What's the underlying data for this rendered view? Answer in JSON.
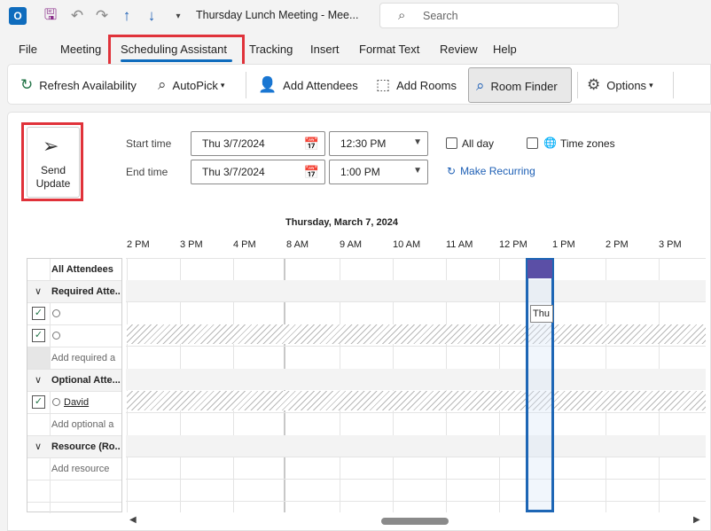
{
  "titlebar": {
    "app_icon": "outlook-icon",
    "app_letter": "O",
    "title": "Thursday Lunch Meeting  -  Mee...",
    "search_placeholder": "Search"
  },
  "menu": {
    "tabs": [
      "File",
      "Meeting",
      "Scheduling Assistant",
      "Tracking",
      "Insert",
      "Format Text",
      "Review",
      "Help"
    ],
    "active": "Scheduling Assistant"
  },
  "ribbon": {
    "refresh": "Refresh Availability",
    "autopick": "AutoPick",
    "add_attendees": "Add Attendees",
    "add_rooms": "Add Rooms",
    "room_finder": "Room Finder",
    "options": "Options"
  },
  "form": {
    "send_label_1": "Send",
    "send_label_2": "Update",
    "start_label": "Start time",
    "end_label": "End time",
    "start_date": "Thu 3/7/2024",
    "start_time": "12:30 PM",
    "end_date": "Thu 3/7/2024",
    "end_time": "1:00 PM",
    "all_day": "All day",
    "time_zones": "Time zones",
    "make_recurring": "Make Recurring"
  },
  "grid": {
    "date_header": "Thursday, March 7, 2024",
    "hours": [
      "2 PM",
      "3 PM",
      "4 PM",
      "8 AM",
      "9 AM",
      "10 AM",
      "11 AM",
      "12 PM",
      "1 PM",
      "2 PM",
      "3 PM"
    ],
    "tooltip": "Thu"
  },
  "attendees": {
    "all_attendees": "All Attendees",
    "required_group": "Required Atte...",
    "required_add": "Add required a",
    "optional_group": "Optional Atte...",
    "optional_name": "David",
    "optional_add": "Add optional a",
    "resource_group": "Resource (Ro...",
    "resource_add": "Add resource"
  },
  "colors": {
    "accent": "#0f6cbd",
    "busy": "#5b4fa6",
    "highlight": "#e0323a"
  }
}
